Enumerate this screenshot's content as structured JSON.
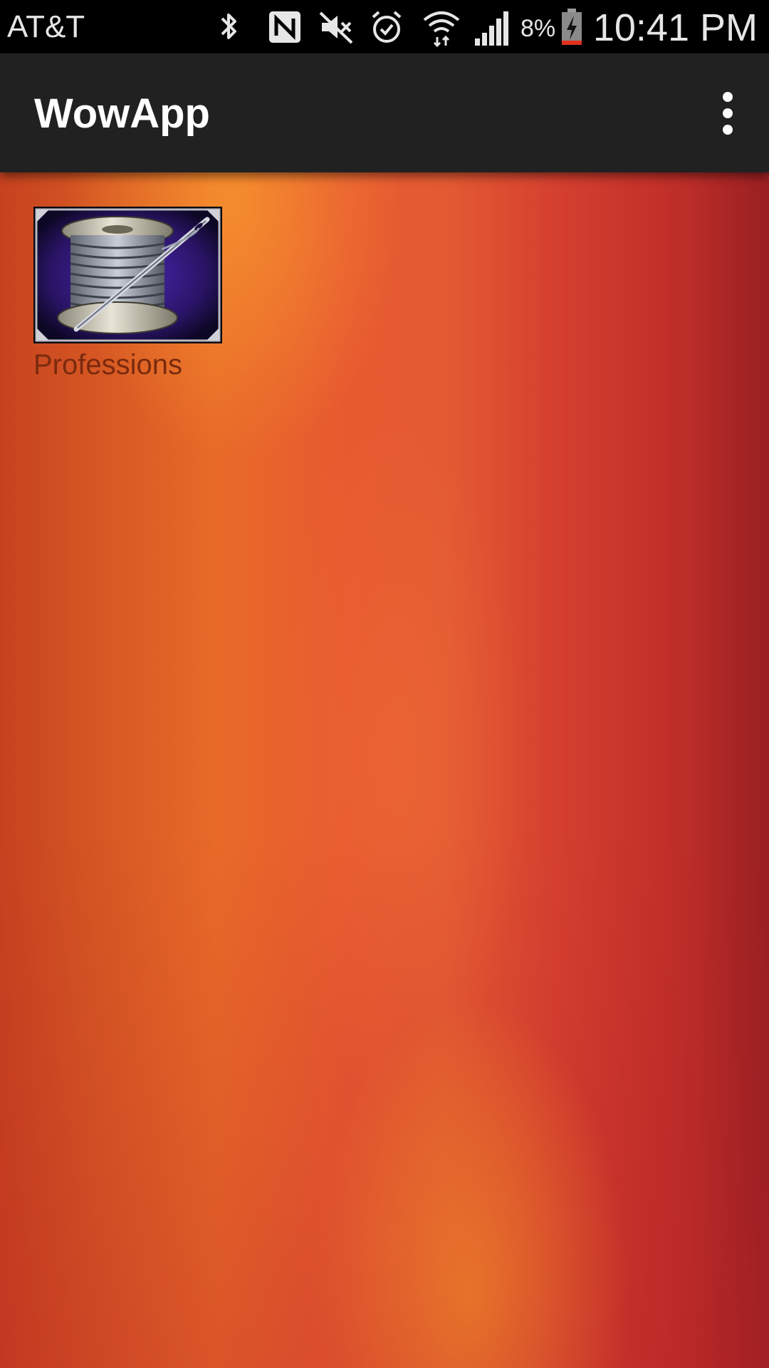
{
  "status_bar": {
    "carrier": "AT&T",
    "battery_percent": "8%",
    "time": "10:41 PM",
    "icons": [
      "bluetooth-icon",
      "nfc-icon",
      "mute-icon",
      "alarm-icon",
      "wifi-icon",
      "signal-icon",
      "battery-charging-icon"
    ]
  },
  "app_bar": {
    "title": "WowApp",
    "menu_icon": "overflow-menu-icon",
    "background": "#212121"
  },
  "content": {
    "tiles": [
      {
        "label": "Professions",
        "icon": "thread-spool-needle-icon"
      }
    ],
    "background_colors": [
      "#c6421f",
      "#e86a28",
      "#f08a2a",
      "#a52425"
    ]
  }
}
